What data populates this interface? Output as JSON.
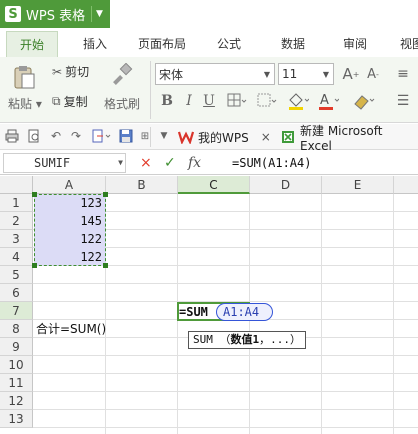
{
  "app": {
    "name": "WPS 表格",
    "logo_letter": "S",
    "brand_color": "#4f9a3a"
  },
  "ribbon_tabs": [
    "开始",
    "插入",
    "页面布局",
    "公式",
    "数据",
    "审阅",
    "视图"
  ],
  "active_tab": "开始",
  "clipboard": {
    "paste": "粘贴",
    "cut": "剪切",
    "copy": "复制",
    "format_painter": "格式刷"
  },
  "font": {
    "name": "宋体",
    "size": "11",
    "bold": "B",
    "italic": "I",
    "underline": "U",
    "grow": "A",
    "shrink": "A"
  },
  "quick_access": {
    "docs": [
      {
        "label": "我的WPS",
        "close": "×"
      },
      {
        "label": "新建 Microsoft Excel"
      }
    ]
  },
  "formula_bar": {
    "name_box": "SUMIF",
    "cancel": "×",
    "confirm": "✓",
    "fx": "fx",
    "formula": "=SUM(A1:A4)"
  },
  "columns": [
    "A",
    "B",
    "C",
    "D",
    "E"
  ],
  "rows": [
    "1",
    "2",
    "3",
    "4",
    "5",
    "6",
    "7",
    "8",
    "9",
    "10",
    "11",
    "12",
    "13"
  ],
  "cells": {
    "A1": "123",
    "A2": "145",
    "A3": "122",
    "A4": "122",
    "A8": "合计=SUM()"
  },
  "active_cell": {
    "ref": "C7",
    "edit_text": "=SUM",
    "ref_text": "A1:A4"
  },
  "tooltip": {
    "func": "SUM",
    "open": "（",
    "arg": "数值1",
    "rest": "，...）"
  }
}
